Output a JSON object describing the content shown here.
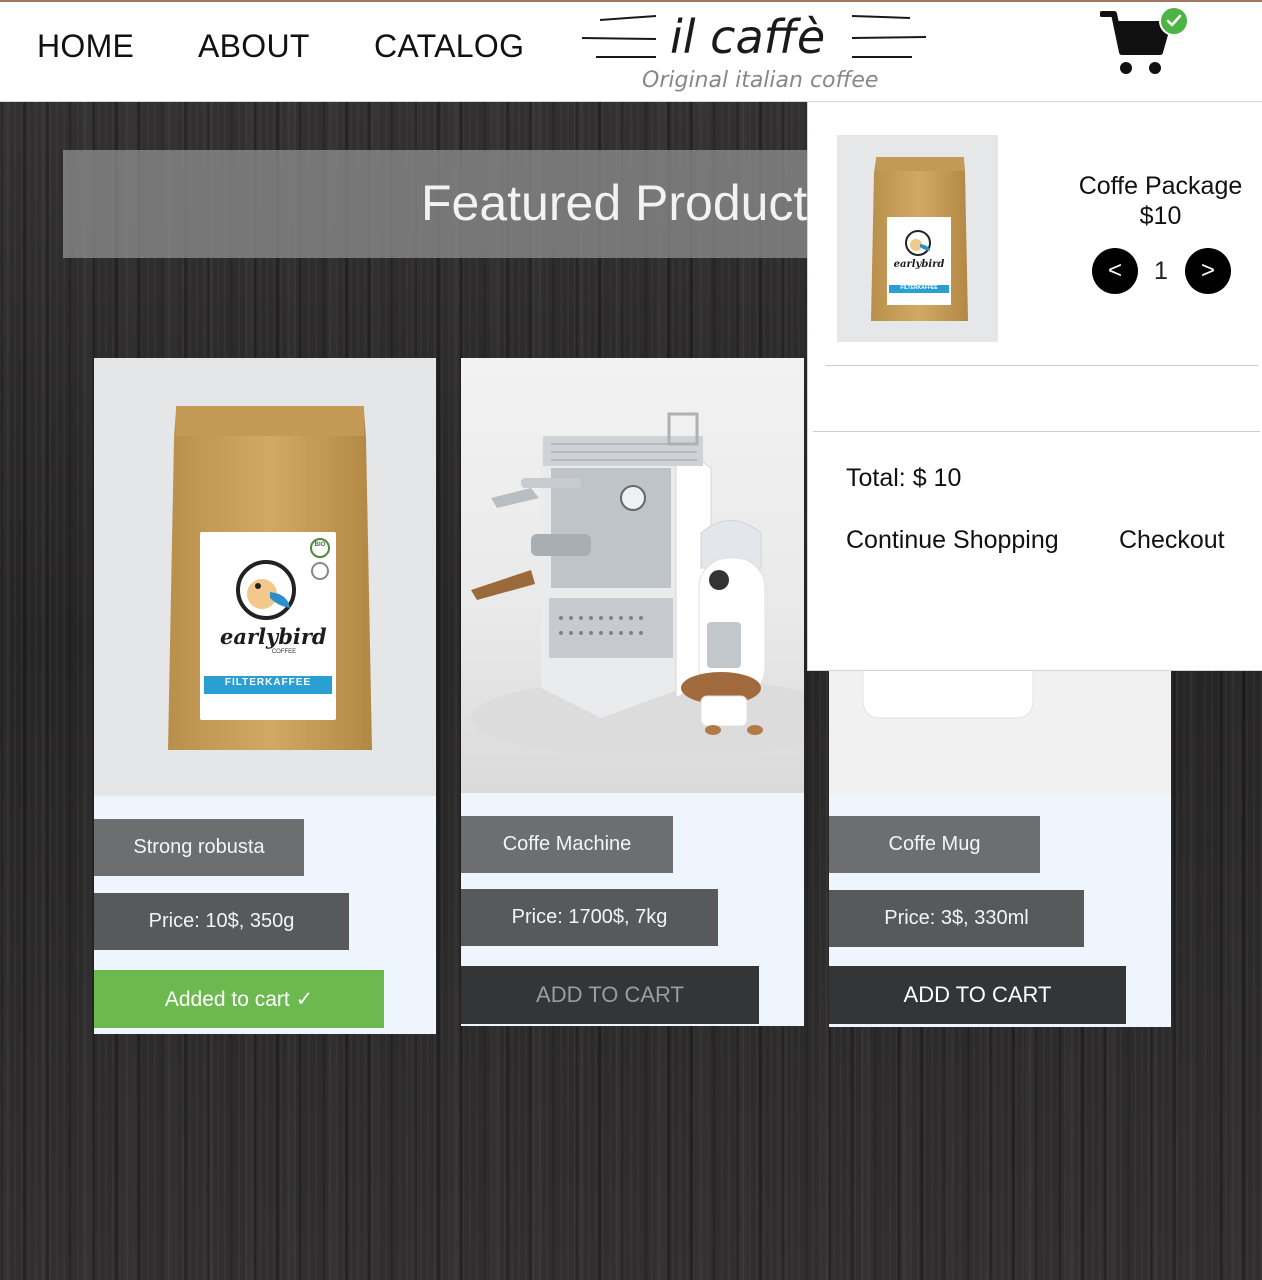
{
  "nav": {
    "home": "HOME",
    "about": "ABOUT",
    "catalog": "CATALOG"
  },
  "logo": {
    "title": "il caffè",
    "subtitle": "Original italian coffee"
  },
  "cart_badge": {
    "icon": "check-icon",
    "color": "#4db344"
  },
  "featured": {
    "title": "Featured Products"
  },
  "products": [
    {
      "name": "Strong robusta",
      "price": "Price: 10$, 350g",
      "button": "Added to cart ✓",
      "state": "added",
      "image": "coffee-bag",
      "bag_brand": "earlybird",
      "bag_brand_sub": "COFFEE",
      "bag_label": "FILTERKAFFEE",
      "bag_badge": "BIO"
    },
    {
      "name": "Coffe Machine",
      "price": "Price: 1700$, 7kg",
      "button": "ADD TO CART",
      "state": "default",
      "image": "espresso-machine"
    },
    {
      "name": "Coffe Mug",
      "price": "Price: 3$, 330ml",
      "button": "ADD TO CART",
      "state": "default",
      "image": "coffee-mug"
    }
  ],
  "cart": {
    "item_name": "Coffe Package",
    "item_price": "$10",
    "quantity": "1",
    "dec_label": "<",
    "inc_label": ">",
    "total": "Total: $ 10",
    "continue_label": "Continue Shopping",
    "checkout_label": "Checkout",
    "mini_brand": "earlybird",
    "mini_label": "FILTERKAFFEE"
  },
  "colors": {
    "added_button": "#6cb94f",
    "button_dark": "#343537",
    "tag": "#6d6e70",
    "accent_line": "#a0785f"
  }
}
